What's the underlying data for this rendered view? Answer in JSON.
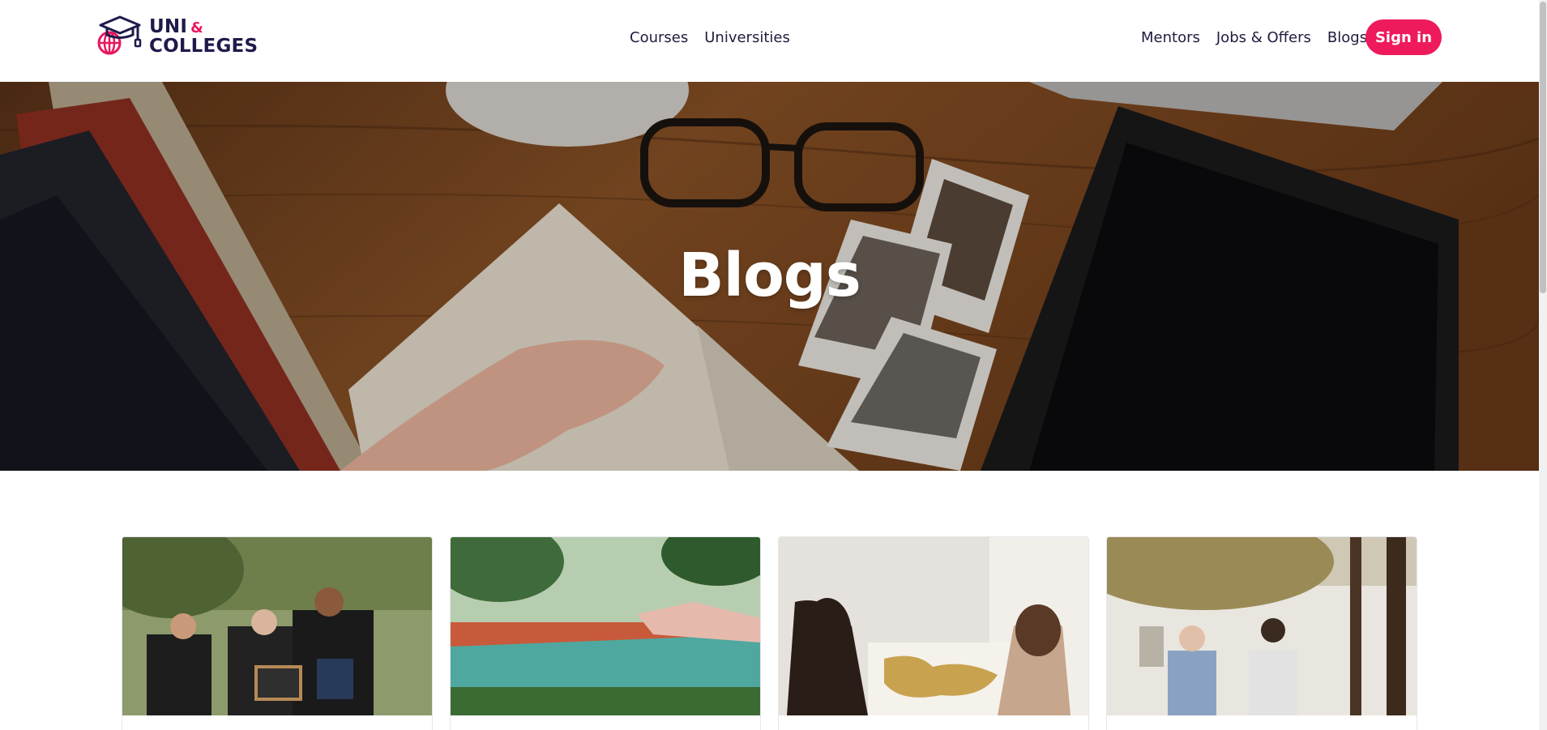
{
  "header": {
    "logo": {
      "line1": "UNI",
      "amp": "&",
      "line2": "COLLEGES"
    },
    "nav_center": [
      {
        "label": "Courses"
      },
      {
        "label": "Universities"
      }
    ],
    "nav_right": [
      {
        "label": "Mentors"
      },
      {
        "label": "Jobs & Offers"
      },
      {
        "label": "Blogs"
      }
    ],
    "signin_label": "Sign in",
    "accent_color": "#ee1a5c",
    "brand_color": "#1e1b4b"
  },
  "hero": {
    "title": "Blogs"
  },
  "blog_cards": [
    {
      "image": "graduates-celebrating"
    },
    {
      "image": "resort-pool"
    },
    {
      "image": "world-map-discussion"
    },
    {
      "image": "students-walking-campus"
    }
  ]
}
